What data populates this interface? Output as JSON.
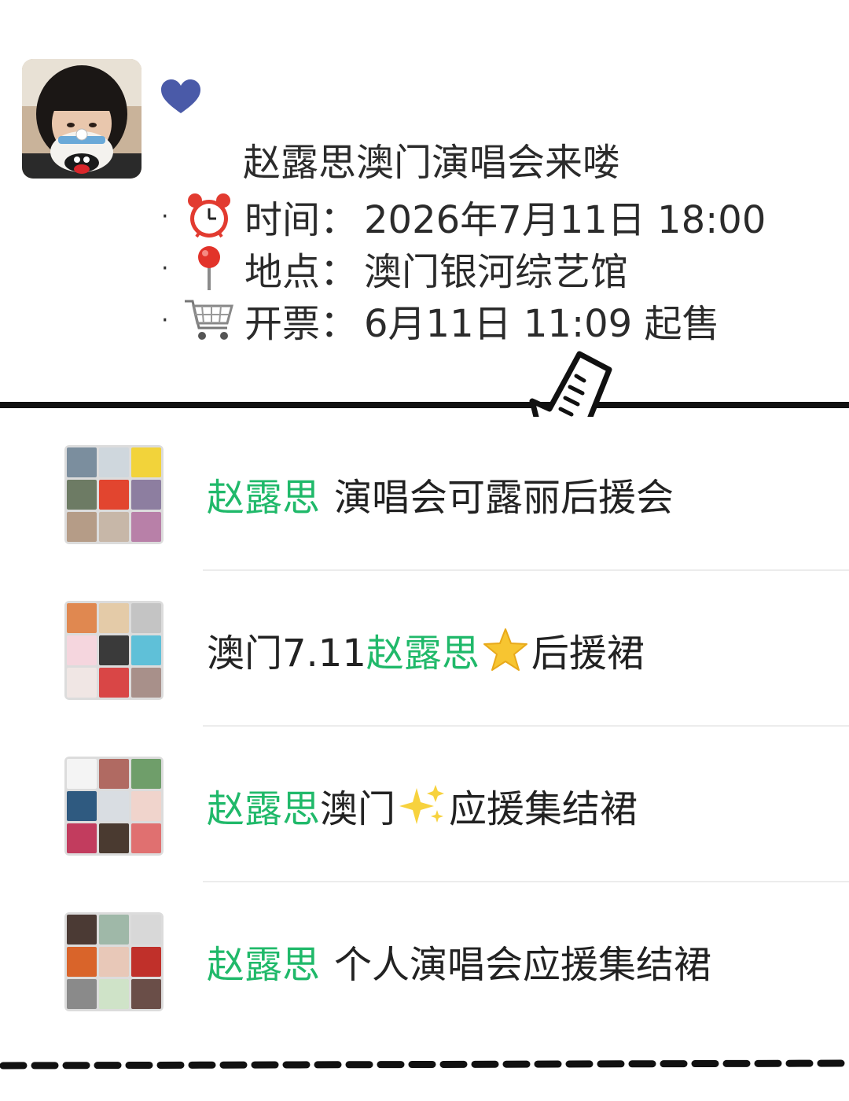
{
  "event": {
    "title": "赵露思澳门演唱会来喽",
    "rows": [
      {
        "icon": "alarm-clock-icon",
        "label": "时间",
        "value": "2026年7月11日 18:00"
      },
      {
        "icon": "pin-icon",
        "label": "地点",
        "value": "澳门银河综艺馆"
      },
      {
        "icon": "shopping-cart-icon",
        "label": "开票",
        "value": "6月11日 11:09 起售"
      }
    ],
    "bullet": "·",
    "colon": "："
  },
  "groups": [
    {
      "highlight": "赵露思",
      "rest": "演唱会可露丽后援会",
      "prefix": "",
      "emoji": ""
    },
    {
      "prefix": "澳门7.11",
      "highlight": "赵露思",
      "emoji": "star-icon",
      "rest": "后援裙"
    },
    {
      "highlight": "赵露思",
      "rest2": "澳门",
      "emoji": "sparkles-icon",
      "rest": "应援集结裙"
    },
    {
      "highlight": "赵露思",
      "rest": "个人演唱会应援集结裙",
      "prefix": "",
      "emoji": ""
    }
  ],
  "colors": {
    "accent_green": "#20b96a",
    "text": "#222222",
    "divider": "#111111",
    "heart": "#4a5aa8"
  }
}
